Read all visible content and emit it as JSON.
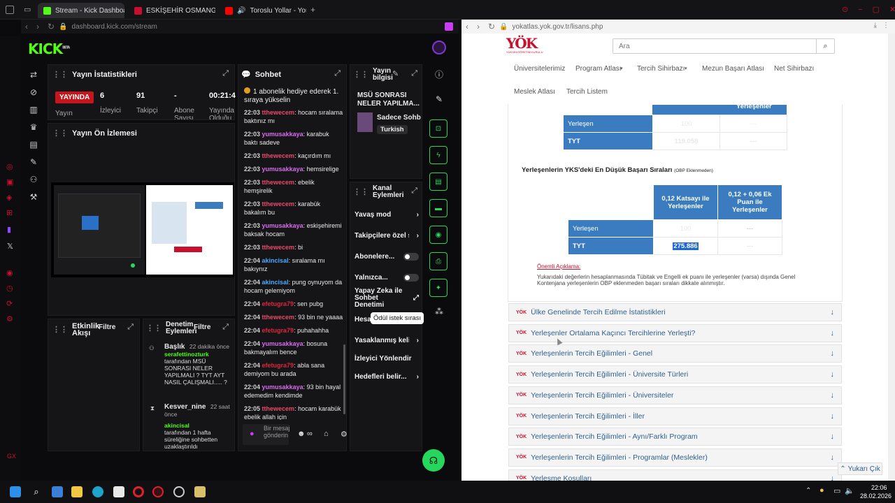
{
  "browser_left": {
    "tabs": [
      {
        "label": "Stream - Kick Dashboard",
        "color": "#53fc18"
      },
      {
        "label": "ESKİŞEHİR OSMANGAZİ Ü",
        "color": "#c8102e"
      },
      {
        "label": "Toroslu Yollar - YouTub",
        "color": "#ff0000"
      }
    ],
    "url": "dashboard.kick.com/stream"
  },
  "browser_right": {
    "url": "yokatlas.yok.gov.tr/lisans.php"
  },
  "kick": {
    "logo": "KICK",
    "logo_beta": "BETA",
    "stats": {
      "title": "Yayın İstatistikleri",
      "live": "YAYINDA",
      "viewers": "6",
      "followers": "91",
      "subs": "-",
      "duration": "00:21:4",
      "l_live": "Yayın",
      "l_viewers": "İzleyici",
      "l_followers": "Takipçi",
      "l_subs": "Abone Sayısı",
      "l_duration": "Yayında Olduğu"
    },
    "preview": {
      "title": "Yayın Ön İzlemesi"
    },
    "activity": {
      "title": "Etkinlik Akışı",
      "filter": "Filtre"
    },
    "audit": {
      "title": "Denetim Eylemleri",
      "filter": "Filtre",
      "items": [
        {
          "heading": "Başlık",
          "time": "22 dakika önce",
          "user": "serafettinozturk",
          "text": "tarafından MSÜ SONRASI NELER YAPILMALI ? TYT AYT NASIL ÇALIŞMALI..... ? olarak değiştirildi"
        },
        {
          "heading": "Kesver_nine",
          "time": "22 saat önce",
          "user": "akincisal",
          "text": "tarafından 1 hafta süreliğine sohbetten uzaklaştırıldı"
        }
      ]
    },
    "chat": {
      "title": "Sohbet",
      "pinned": "1 abonelik hediye ederek 1. sıraya yükselin",
      "input_placeholder": "Bir mesaj gönderin",
      "messages": [
        {
          "time": "22:03",
          "user": "tthewecem",
          "cls": "u1",
          "text": "hocam sıralama baktınız mı"
        },
        {
          "time": "22:03",
          "user": "yumusakkaya",
          "cls": "u2",
          "text": "karabuk baktı sadeve"
        },
        {
          "time": "22:03",
          "user": "tthewecem",
          "cls": "u1",
          "text": "kaçırdım mı"
        },
        {
          "time": "22:03",
          "user": "yumusakkaya",
          "cls": "u2",
          "text": "hemsirelige"
        },
        {
          "time": "22:03",
          "user": "tthewecem",
          "cls": "u1",
          "text": "ebelik hemşirelik"
        },
        {
          "time": "22:03",
          "user": "tthewecem",
          "cls": "u1",
          "text": "karabük bakalım bu"
        },
        {
          "time": "22:03",
          "user": "yumusakkaya",
          "cls": "u2",
          "text": "eskişehiremi baksak hocam"
        },
        {
          "time": "22:03",
          "user": "tthewecem",
          "cls": "u1",
          "text": "bi"
        },
        {
          "time": "22:04",
          "user": "akincisal",
          "cls": "u4",
          "text": "sıralama mı bakıynız"
        },
        {
          "time": "22:04",
          "user": "akincisal",
          "cls": "u4",
          "text": "pung oynuyom da hocam gelemiyom"
        },
        {
          "time": "22:04",
          "user": "efetugra79",
          "cls": "u3",
          "text": "sen pubg"
        },
        {
          "time": "22:04",
          "user": "tthewecem",
          "cls": "u1",
          "text": "93 bin ne yaaaa"
        },
        {
          "time": "22:04",
          "user": "efetugra79",
          "cls": "u3",
          "text": "puhahahha"
        },
        {
          "time": "22:04",
          "user": "yumusakkaya",
          "cls": "u2",
          "text": "bosuna bakmayalım bence"
        },
        {
          "time": "22:04",
          "user": "efetugra79",
          "cls": "u3",
          "text": "abla sana demiyom bu arada"
        },
        {
          "time": "22:04",
          "user": "yumusakkaya",
          "cls": "u2",
          "text": "93 bin hayal edemedim kendimde"
        },
        {
          "time": "22:05",
          "user": "tthewecem",
          "cls": "u1",
          "text": "hocam karabük ebelik allah için"
        }
      ]
    },
    "info": {
      "title": "Yayın bilgisi",
      "stream_title": "MSÜ SONRASI NELER YAPILMA...",
      "category": "Sadece Sohb",
      "language": "Turkish"
    },
    "channel_actions": {
      "title": "Kanal Eylemleri",
      "items": [
        "Yavaş mod",
        "Takipçilere özel s",
        "Abonelere...",
        "Yalnızca...",
        "Yapay Zeka ile Sohbet Denetimi",
        "Hesap",
        "Yasaklanmış keli",
        "İzleyici Yönlendir",
        "Hedefleri belir..."
      ],
      "tooltip": "Ödül istek sırası"
    }
  },
  "yok": {
    "search_placeholder": "Ara",
    "logo_sub": "YÜKSEKÖĞRETİM KURULU",
    "nav": [
      "Üniversitelerimiz",
      "Program Atlası",
      "Tercih Sihirbazı",
      "Mezun Başarı Atlası",
      "Net Sihirbazı",
      "Meslek Atlası",
      "Tercih Listem"
    ],
    "table1": {
      "header_partial": "Yerleşenler",
      "rows": [
        [
          "Yerleşen",
          "100",
          "---"
        ],
        [
          "TYT",
          "119.058",
          "---"
        ]
      ]
    },
    "section_title": "Yerleşenlerin YKS'deki En Düşük Başarı Sıraları",
    "section_note": "(OBP Eklenmeden)",
    "table2": {
      "headers": [
        "0,12 Katsayı ile Yerleşenler",
        "0,12 + 0,06 Ek Puan ile Yerleşenler"
      ],
      "rows": [
        [
          "Yerleşen",
          "100",
          "---"
        ],
        [
          "TYT",
          "275.886",
          "---"
        ]
      ]
    },
    "note_title": "Önemli Açıklama:",
    "note_text": "Yukarıdaki değerlerin hesaplanmasında Tübitak ve Engelli ek puanı ile yerleşenler (varsa) dışında Genel Kontenjana yerleşenlerin OBP eklenmeden başarı sıraları dikkate alınmıştır.",
    "accordions": [
      "Ülke Genelinde Tercih Edilme İstatistikleri",
      "Yerleşenler Ortalama Kaçıncı Tercihlerine Yerleşti?",
      "Yerleşenlerin Tercih Eğilimleri - Genel",
      "Yerleşenlerin Tercih Eğilimleri - Üniversite Türleri",
      "Yerleşenlerin Tercih Eğilimleri - Üniversiteler",
      "Yerleşenlerin Tercih Eğilimleri - İller",
      "Yerleşenlerin Tercih Eğilimleri - Aynı/Farklı Program",
      "Yerleşenlerin Tercih Eğilimleri - Programlar (Meslekler)",
      "Yerleşme Koşulları"
    ],
    "back_to_top": "Yukarı Çık"
  },
  "taskbar": {
    "time": "22:06",
    "date": "28.02.2026"
  },
  "colors": {
    "kick_green": "#53fc18",
    "yok_blue": "#3a7cbf",
    "yok_red": "#c8102e"
  }
}
